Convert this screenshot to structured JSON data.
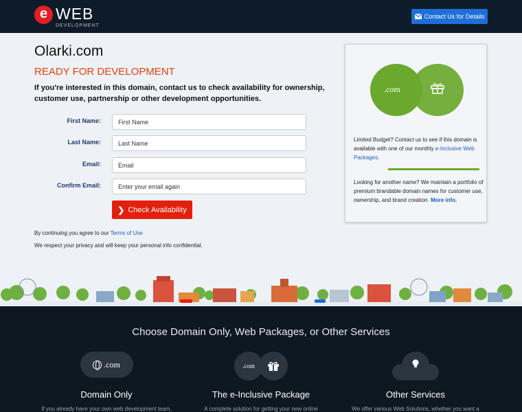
{
  "header": {
    "logo_e": "e",
    "logo_web": "WEB",
    "logo_sub": "DEVELOPMENT",
    "contact_label": "Contact Us for Details"
  },
  "main": {
    "domain": "Olarki.com",
    "status": "READY FOR DEVELOPMENT",
    "intro": "If you're interested in this domain, contact us to check availability for ownership, customer use, partnership or other development opportunities."
  },
  "form": {
    "fields": [
      {
        "label": "First Name:",
        "placeholder": "First Name"
      },
      {
        "label": "Last Name:",
        "placeholder": "Last Name"
      },
      {
        "label": "Email:",
        "placeholder": "Email"
      },
      {
        "label": "Confirm Email:",
        "placeholder": "Enter your email again"
      }
    ],
    "submit_label": "Check Availability",
    "terms_prefix": "By continuing you agree to our",
    "terms_link": "Terms of Use",
    "privacy": "We respect your privacy and will keep your personal info confidential."
  },
  "card": {
    "dotcom": ".com",
    "budget_text": "Limited Budget? Contact us to see if this domain is available with one of our monthly",
    "budget_link": "e-Inclusive Web Packages",
    "budget_end": ".",
    "portfolio_text": "Looking for another name? We maintain a portfolio of premium brandable domain names for customer use, ownership, and brand creation.",
    "portfolio_link": "More info."
  },
  "footer": {
    "title": "Choose Domain Only, Web Packages, or Other Services",
    "services": [
      {
        "icon_text": ".com",
        "label": "Domain Only",
        "desc": "If you already have your own web development team,"
      },
      {
        "icon_text": ".com",
        "label": "The e-Inclusive Package",
        "desc": "A complete solution for getting your new online"
      },
      {
        "label": "Other Services",
        "desc": "We offer various Web Solutions, whether you want a"
      }
    ]
  },
  "colors": {
    "header_bg": "#0d1b2a",
    "accent_blue": "#1e6fd9",
    "accent_red": "#e3200d",
    "accent_orange": "#e8410f",
    "venn_green": "#6aa92e",
    "footer_bg": "#0e1821"
  }
}
